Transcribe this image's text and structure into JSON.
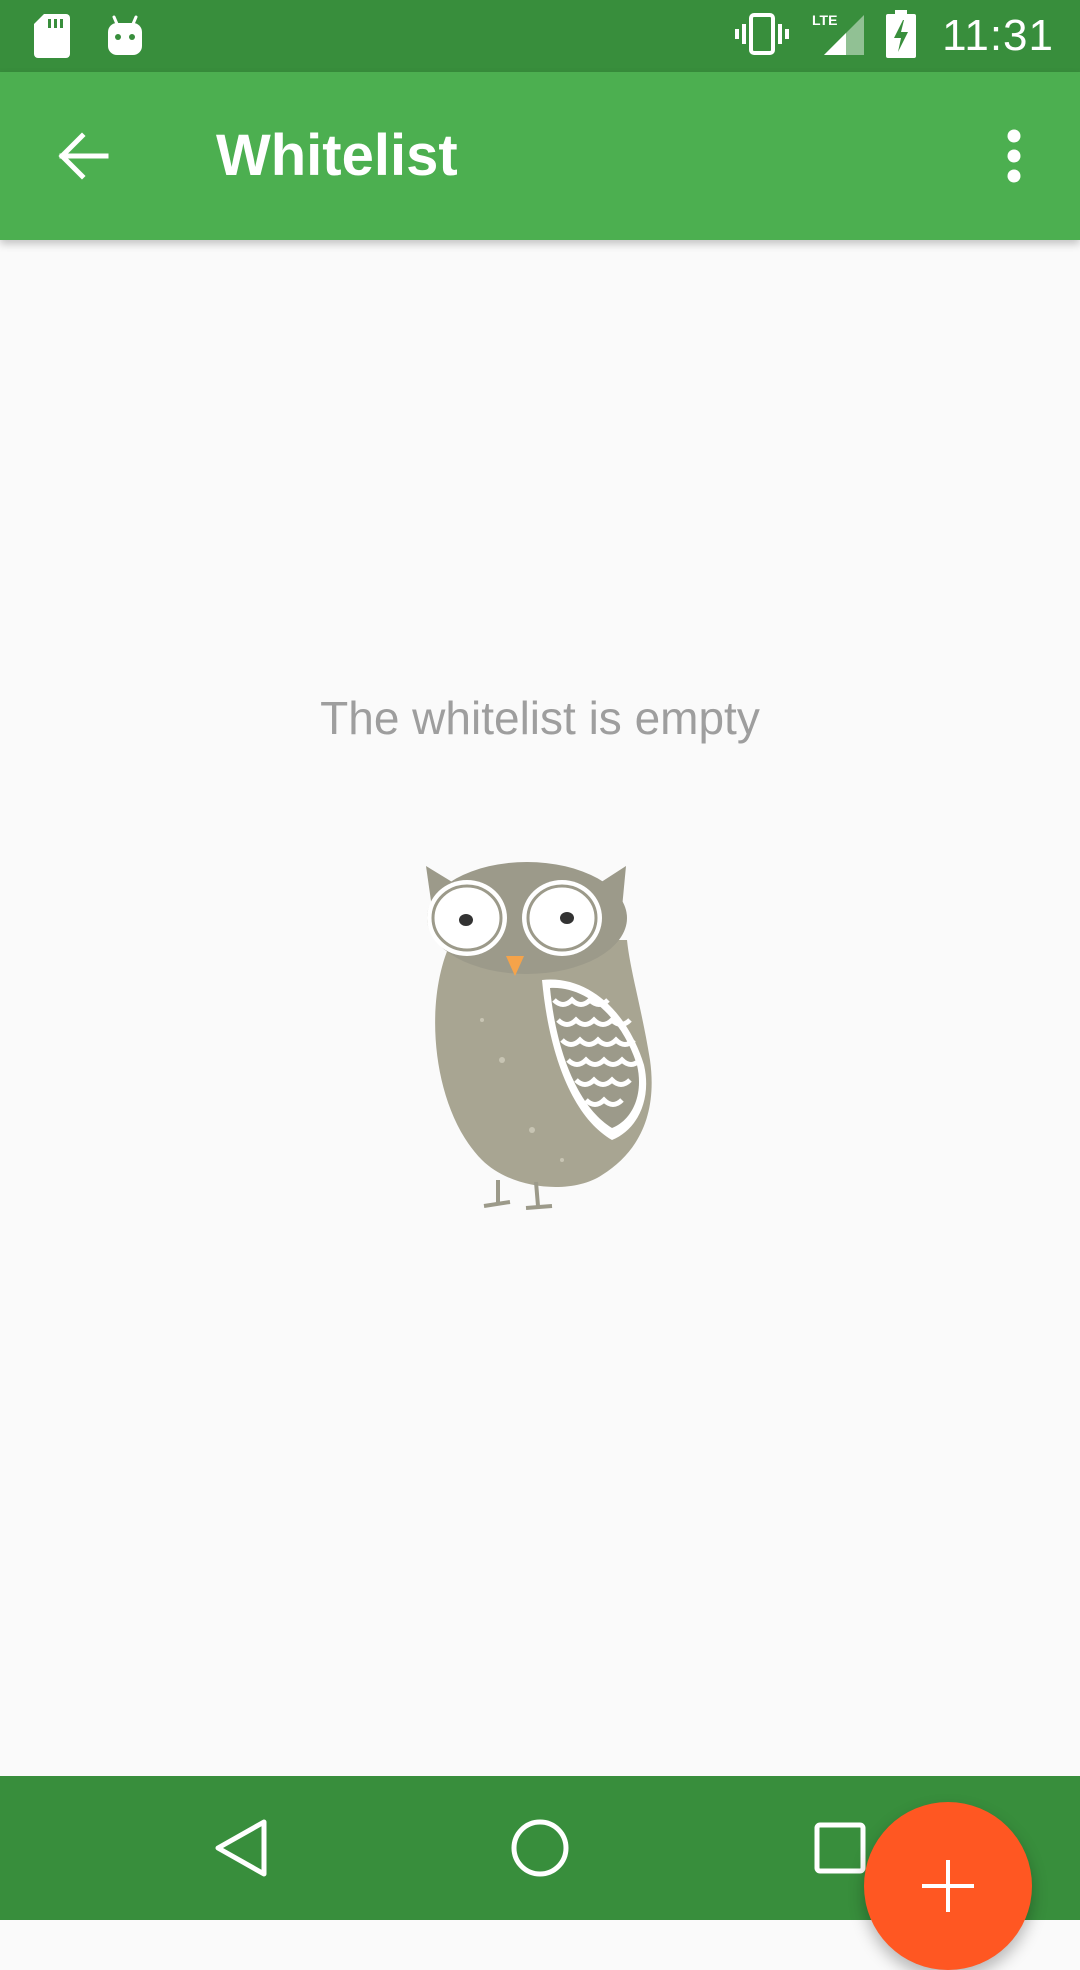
{
  "status_bar": {
    "time": "11:31",
    "network_type": "LTE",
    "left_icons": [
      "sd-card-icon",
      "android-icon"
    ],
    "right_icons": [
      "vibrate-icon",
      "lte-signal-icon",
      "battery-charging-icon"
    ]
  },
  "app_bar": {
    "title": "Whitelist",
    "back_icon": "arrow-back-icon",
    "overflow_icon": "more-vert-icon"
  },
  "empty_state": {
    "message": "The whitelist is empty",
    "illustration": "owl-illustration"
  },
  "fab": {
    "icon": "add-icon"
  },
  "nav_bar": {
    "buttons": [
      "back-triangle-icon",
      "home-circle-icon",
      "recents-square-icon"
    ]
  },
  "colors": {
    "status_bar": "#388E3C",
    "app_bar": "#4CAF50",
    "fab": "#FF5722",
    "background": "#FAFAFA",
    "empty_text": "#9E9E9E"
  }
}
